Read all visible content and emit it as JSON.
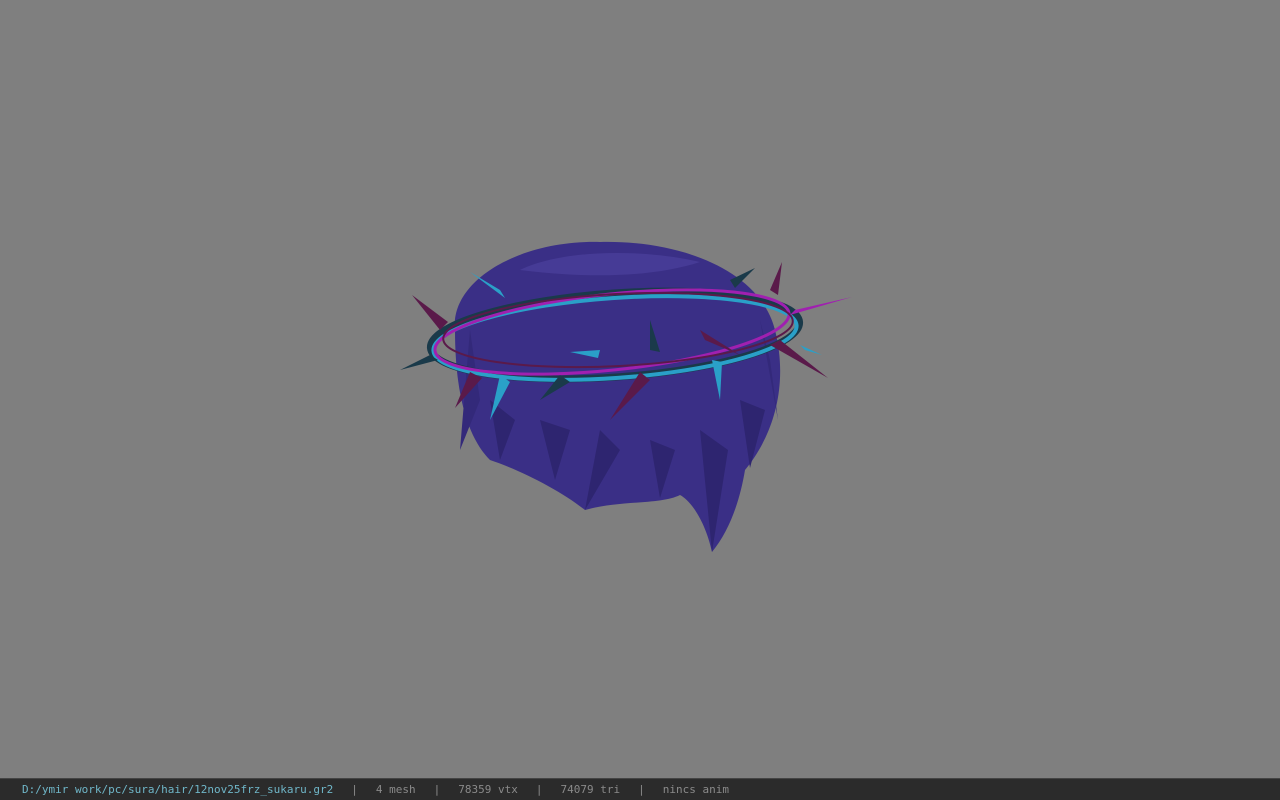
{
  "viewport": {
    "background": "#7f7f7f",
    "model": {
      "hair_color": "#3a2f86",
      "crown_colors": [
        "#2aa0c8",
        "#a020b0",
        "#5a1a4a",
        "#1a3a4a"
      ]
    }
  },
  "statusbar": {
    "path": "D:/ymir work/pc/sura/hair/12nov25frz_sukaru.gr2",
    "separator": "|",
    "mesh": "4 mesh",
    "vtx": "78359 vtx",
    "tri": "74079 tri",
    "anim": "nincs anim",
    "path_color": "#6fb6c8"
  }
}
